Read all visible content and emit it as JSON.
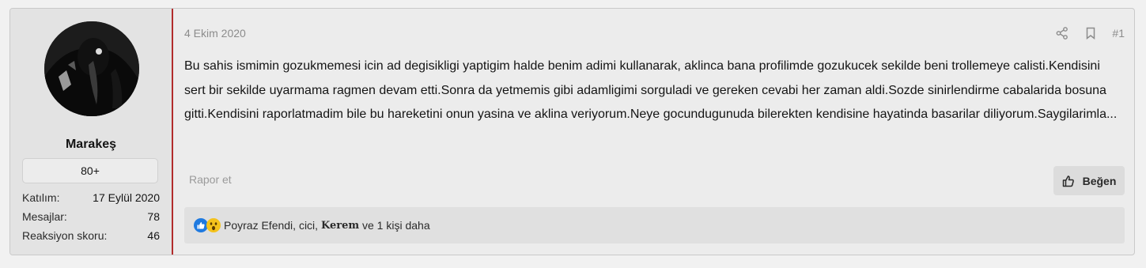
{
  "post": {
    "date": "4 Ekim 2020",
    "number": "#1",
    "message": "Bu sahis ismimin gozukmemesi icin ad degisikligi yaptigim halde benim adimi kullanarak, aklinca bana profilimde gozukucek sekilde beni trollemeye calisti.Kendisini sert bir sekilde uyarmama ragmen devam etti.Sonra da yetmemis gibi adamligimi sorguladi ve gereken cevabi her zaman aldi.Sozde sinirlendirme cabalarida bosuna gitti.Kendisini raporlatmadim bile bu hareketini onun yasina ve aklina veriyorum.Neye gocundugunuda bilerekten kendisine hayatinda basarilar diliyorum.Saygilarimla...",
    "report_label": "Rapor et",
    "like_label": "Beğen",
    "icons": {
      "share": "share-icon",
      "bookmark": "bookmark-icon",
      "like": "thumbs-up-icon"
    }
  },
  "user": {
    "name": "Marakeş",
    "badge": "80+",
    "stats": [
      {
        "label": "Katılım:",
        "value": "17 Eylül 2020"
      },
      {
        "label": "Mesajlar:",
        "value": "78"
      },
      {
        "label": "Reaksiyon skoru:",
        "value": "46"
      }
    ]
  },
  "reactions": {
    "icons": [
      "like-reaction-icon",
      "wow-reaction-icon"
    ],
    "names_prefix": "Poyraz Efendi, cici, ",
    "bold_name": "Kerem",
    "suffix": " ve 1 kişi daha"
  },
  "colors": {
    "accent_border": "#b22b2b",
    "like_blue": "#1f7ae0",
    "wow_yellow": "#f4c21c"
  }
}
